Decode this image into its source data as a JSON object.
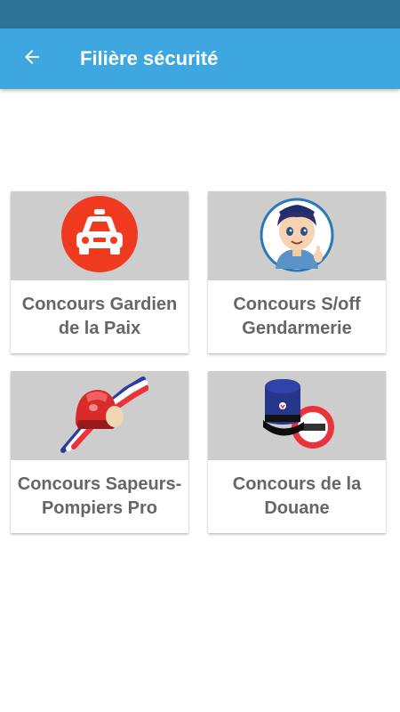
{
  "header": {
    "title": "Filière sécurité",
    "back_icon": "arrow-left-icon",
    "bar_color": "#3fa7e0",
    "status_color": "#2d7397"
  },
  "cards": [
    {
      "label": "Concours Gardien de la Paix",
      "icon": "police-car-icon"
    },
    {
      "label": "Concours S/off Gendarmerie",
      "icon": "gendarme-icon"
    },
    {
      "label": "Concours Sapeurs-Pompiers Pro",
      "icon": "firefighter-helmet-icon"
    },
    {
      "label": "Concours de la Douane",
      "icon": "customs-cap-icon"
    }
  ]
}
